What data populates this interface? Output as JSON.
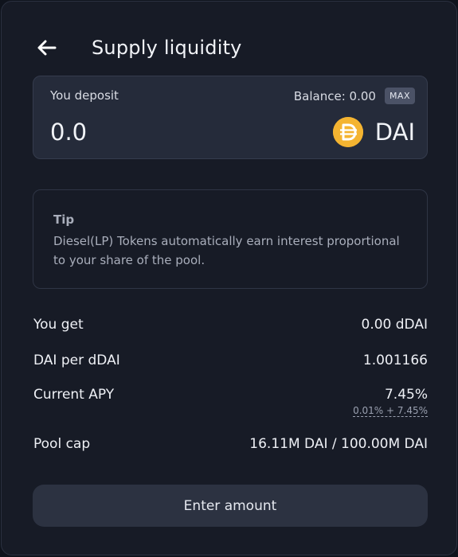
{
  "header": {
    "title": "Supply liquidity",
    "back_icon": "arrow-left-icon"
  },
  "deposit": {
    "label": "You deposit",
    "balance_text": "Balance: 0.00",
    "max_label": "MAX",
    "amount_placeholder": "0.0",
    "token_symbol": "DAI",
    "token_icon": "dai-icon",
    "token_color": "#f4b431"
  },
  "tip": {
    "title": "Tip",
    "text": "Diesel(LP) Tokens automatically earn interest proportional to your share of the pool."
  },
  "info": {
    "you_get": {
      "label": "You get",
      "value": "0.00 dDAI"
    },
    "rate": {
      "label": "DAI per dDAI",
      "value": "1.001166"
    },
    "apy": {
      "label": "Current APY",
      "value": "7.45%",
      "breakdown": "0.01% + 7.45%"
    },
    "pool_cap": {
      "label": "Pool cap",
      "value": "16.11M DAI / 100.00M DAI"
    }
  },
  "action": {
    "button_label": "Enter amount"
  }
}
